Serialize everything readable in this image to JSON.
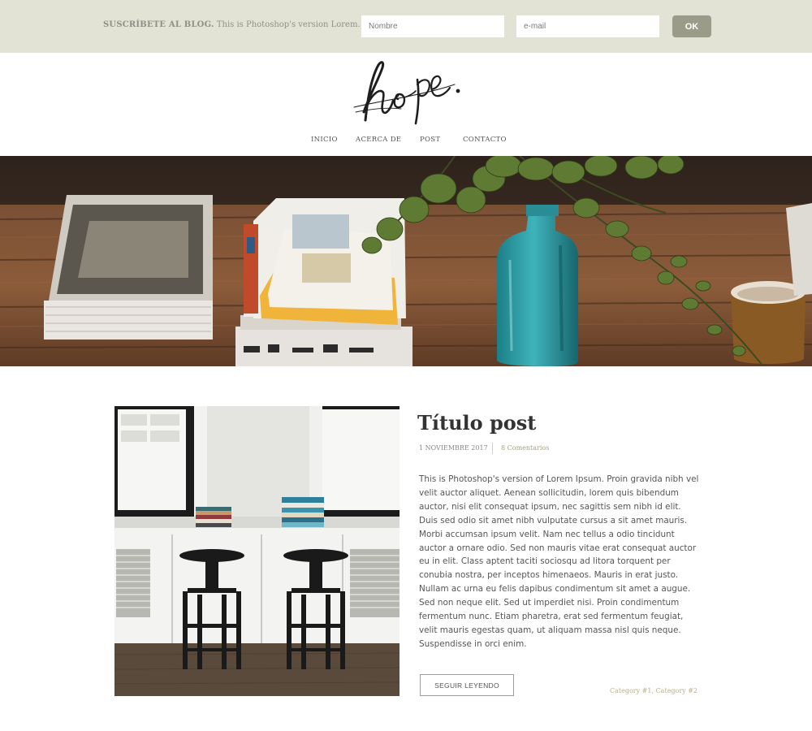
{
  "subscribe": {
    "label": "SUSCRÍBETE AL BLOG.",
    "text": "This is Photoshop's version Lorem.",
    "name_placeholder": "Nombre",
    "email_placeholder": "e-mail",
    "ok_label": "OK"
  },
  "logo": {
    "text": "hope."
  },
  "nav": {
    "items": [
      {
        "label": "INICIO"
      },
      {
        "label": "ACERCA DE"
      },
      {
        "label": "POST"
      },
      {
        "label": "CONTACTO"
      }
    ]
  },
  "post": {
    "title": "Título post",
    "date": "1 NOVIEMBRE 2017",
    "comments": "8 Comentarios",
    "body": "This is Photoshop's version  of Lorem Ipsum. Proin gravida nibh vel velit auctor aliquet. Aenean sollicitudin, lorem quis bibendum auctor, nisi elit consequat ipsum, nec sagittis sem nibh id elit. Duis sed odio sit amet nibh vulputate cursus a sit amet mauris. Morbi accumsan ipsum velit. Nam nec tellus a odio tincidunt auctor a ornare odio. Sed non  mauris vitae erat consequat auctor eu in elit. Class aptent taciti sociosqu ad litora torquent per conubia nostra, per inceptos himenaeos. Mauris in erat justo. Nullam ac urna eu felis dapibus condimentum sit amet a augue. Sed non neque elit. Sed ut imperdiet nisi. Proin condimentum fermentum nunc. Etiam pharetra, erat sed fermentum feugiat, velit mauris egestas quam, ut aliquam massa nisl quis neque. Suspendisse in orci enim.",
    "read_more": "SEGUIR LEYENDO",
    "categories": [
      "Category #1",
      "Category #2"
    ],
    "category_separator": ", "
  },
  "colors": {
    "subscribe_bar": "#e3e3d5",
    "ok_button": "#9a9b88",
    "accent_text": "#a6a27e",
    "category_text": "#b5b08a"
  },
  "icons": {
    "logo": "hope-script-logo",
    "hero": "desk-books-plant-photo",
    "post_image": "window-stools-photo"
  }
}
